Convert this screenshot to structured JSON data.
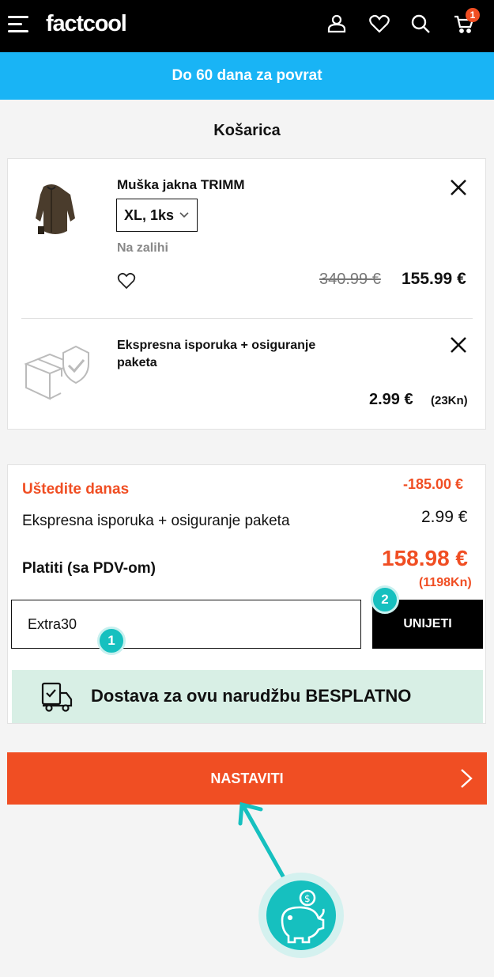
{
  "header": {
    "logo": "factcool",
    "cart_count": "1"
  },
  "promo_banner": "Do 60 dana za povrat",
  "page_title": "Košarica",
  "cart_items": [
    {
      "name": "Muška jakna TRIMM",
      "variant": "XL, 1ks",
      "stock": "Na zalihi",
      "old_price": "340.99 €",
      "price": "155.99 €"
    }
  ],
  "shipping_item": {
    "name": "Ekspresna isporuka + osiguranje paketa",
    "price": "2.99 €",
    "price_kn": "(23Kn)"
  },
  "summary": {
    "savings_label": "Uštedite danas",
    "savings_value": "-185.00 €",
    "shipping_label": "Ekspresna isporuka + osiguranje paketa",
    "shipping_value": "2.99 €",
    "total_label": "Platiti (sa PDV-om)",
    "total_value": "158.98 €",
    "total_kn": "(1198Kn)"
  },
  "coupon": {
    "value": "Extra30",
    "apply_label": "UNIJETI"
  },
  "annotations": {
    "marker_1": "1",
    "marker_2": "2"
  },
  "free_shipping_text": "Dostava za ovu narudžbu BESPLATNO",
  "continue_label": "NASTAVITI",
  "colors": {
    "accent": "#f04e23",
    "promo": "#19b4f5",
    "teal": "#16c0bf",
    "free_banner": "#d8efe5"
  },
  "icons": [
    "menu-icon",
    "user-icon",
    "heart-icon",
    "search-icon",
    "cart-icon",
    "close-icon",
    "chevron-down-icon",
    "package-shield-icon",
    "truck-icon",
    "chevron-right-icon",
    "piggy-bank-icon"
  ]
}
